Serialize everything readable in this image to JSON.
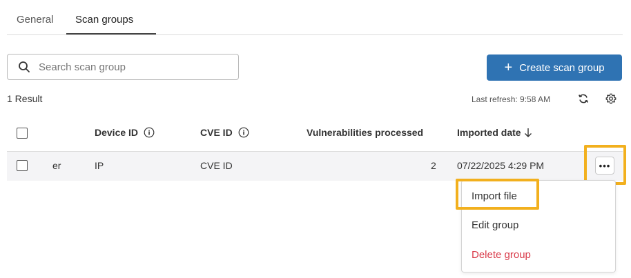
{
  "tabs": [
    {
      "label": "General",
      "active": false
    },
    {
      "label": "Scan groups",
      "active": true
    }
  ],
  "search": {
    "placeholder": "Search scan group",
    "value": ""
  },
  "create_button": {
    "label": "Create scan group"
  },
  "result_count": "1 Result",
  "last_refresh": "Last refresh: 9:58 AM",
  "table": {
    "columns": [
      {
        "label": "Device ID",
        "info": true
      },
      {
        "label": "CVE ID",
        "info": true
      },
      {
        "label": "Vulnerabilities processed",
        "info": false
      },
      {
        "label": "Imported date",
        "sort": "descending"
      }
    ],
    "rows": [
      {
        "name_fragment": "er",
        "device_id": "IP",
        "cve_id": "CVE ID",
        "vulnerabilities_processed": "2",
        "imported_date": "07/22/2025 4:29 PM"
      }
    ]
  },
  "row_menu": {
    "items": [
      {
        "label": "Import file"
      },
      {
        "label": "Edit group"
      },
      {
        "label": "Delete group",
        "danger": true
      }
    ]
  },
  "colors": {
    "accent": "#2f73b3",
    "highlight": "#f2b01e",
    "danger": "#d93b4a"
  }
}
